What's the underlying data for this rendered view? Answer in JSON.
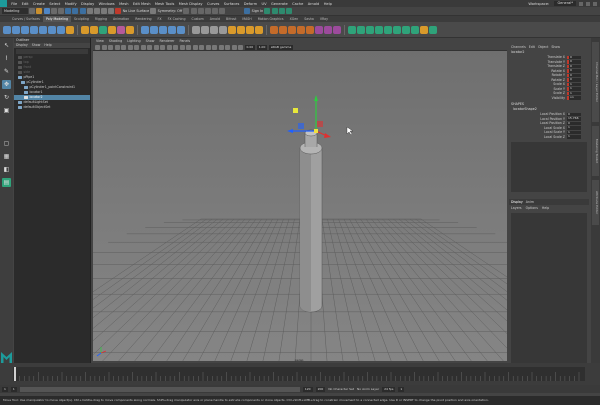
{
  "menubar": {
    "items": [
      "File",
      "Edit",
      "Create",
      "Select",
      "Modify",
      "Display",
      "Windows",
      "Mesh",
      "Edit Mesh",
      "Mesh Tools",
      "Mesh Display",
      "Curves",
      "Surfaces",
      "Deform",
      "UV",
      "Generate",
      "Cache",
      "Arnold",
      "Help"
    ],
    "workspace_label": "Workspace:",
    "workspace_value": "General*"
  },
  "statusline": {
    "mode": "Modeling",
    "no_live": "No Live Surface",
    "symmetry": "Symmetry: Off",
    "sign_in": "Sign In"
  },
  "shelf_tabs": [
    "Curves / Surfaces",
    "Poly Modeling",
    "Sculpting",
    "Rigging",
    "Animation",
    "Rendering",
    "FX",
    "FX Caching",
    "Custom",
    "Arnold",
    "Bifrost",
    "MASH",
    "Motion Graphics",
    "XGen",
    "Sasha",
    "VRay"
  ],
  "shelf_active": "Poly Modeling",
  "outliner": {
    "title": "Outliner",
    "menu": [
      "Display",
      "Show",
      "Help"
    ],
    "rows": [
      {
        "label": "persp",
        "state": "dim"
      },
      {
        "label": "top",
        "state": "dim"
      },
      {
        "label": "front",
        "state": "dim"
      },
      {
        "label": "side",
        "state": "dim"
      },
      {
        "label": "pPipe1",
        "state": "normal"
      },
      {
        "label": "pCylinder1",
        "state": "normal"
      },
      {
        "label": "pCylinder1_pointConstraint1",
        "state": "normal"
      },
      {
        "label": "locator1",
        "state": "normal"
      },
      {
        "label": "locator2",
        "state": "selected"
      },
      {
        "label": "defaultLightSet",
        "state": "normal"
      },
      {
        "label": "defaultObjectSet",
        "state": "normal"
      }
    ]
  },
  "viewport": {
    "menu": [
      "View",
      "Shading",
      "Lighting",
      "Show",
      "Renderer",
      "Panels"
    ],
    "gamma": "sRGB gamma",
    "exposure": "0.00",
    "gamma_value": "1.00",
    "camera_label": "persp"
  },
  "channelbox": {
    "tabs": [
      "Channels",
      "Edit",
      "Object",
      "Show"
    ],
    "object": "locator2",
    "attrs": [
      {
        "label": "Translate X",
        "value": "0"
      },
      {
        "label": "Translate Y",
        "value": "0"
      },
      {
        "label": "Translate Z",
        "value": "0"
      },
      {
        "label": "Rotate X",
        "value": "0"
      },
      {
        "label": "Rotate Y",
        "value": "0"
      },
      {
        "label": "Rotate Z",
        "value": "0"
      },
      {
        "label": "Scale X",
        "value": "1"
      },
      {
        "label": "Scale Y",
        "value": "1"
      },
      {
        "label": "Scale Z",
        "value": "1"
      },
      {
        "label": "Visibility",
        "value": "on"
      }
    ],
    "shapes_title": "SHAPES",
    "shape_name": "locatorShape2",
    "shape_attrs": [
      {
        "label": "Local Position X",
        "value": "0"
      },
      {
        "label": "Local Position Y",
        "value": "15.766"
      },
      {
        "label": "Local Position Z",
        "value": "0"
      },
      {
        "label": "Local Scale X",
        "value": "1"
      },
      {
        "label": "Local Scale Y",
        "value": "1"
      },
      {
        "label": "Local Scale Z",
        "value": "1"
      }
    ]
  },
  "layers": {
    "tabs": [
      "Display",
      "Anim"
    ],
    "menu": [
      "Layers",
      "Options",
      "Help"
    ]
  },
  "vertical_tabs": [
    "Channel Box / Layer Editor",
    "Modeling Toolkit",
    "Attribute Editor"
  ],
  "timeline": {
    "start": "1",
    "end": "120",
    "range_start": "1",
    "range_end": "120",
    "range_end2": "200",
    "current": "1",
    "no_character": "No Character Set",
    "no_anim_layer": "No Anim Layer",
    "fps": "24 fps"
  },
  "helpline": "Move Tool: Use manipulator to move object(s). Ctrl+middle-drag to move components along normals. Shift+drag manipulator axis or plane handle to extrude components or clone objects. Ctrl+Shift+LMB+drag to constrain movement to a connected edge. Use D or INSERT to change the pivot position and axis orientation.",
  "colors": {
    "accent": "#5285a6",
    "maya_teal": "#1d9b9b",
    "keyed_red": "#c0392b"
  }
}
